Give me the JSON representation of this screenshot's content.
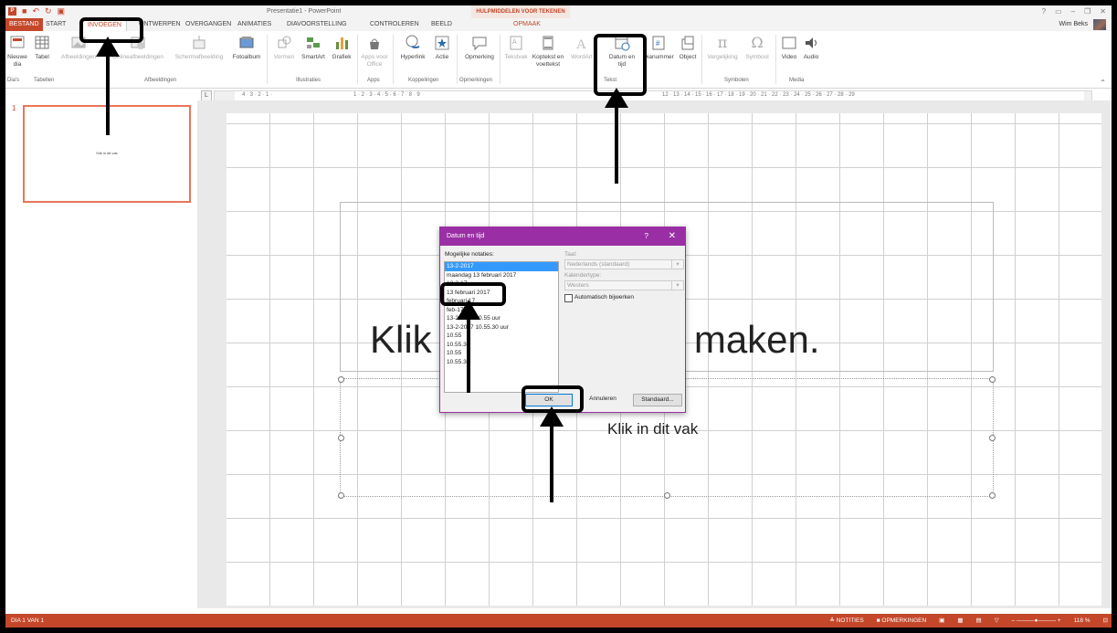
{
  "window": {
    "title": "Presentatie1 - PowerPoint",
    "context_tab": "HULPMIDDELEN VOOR TEKENEN",
    "context_subtab": "OPMAAK",
    "user": "Wim Beks"
  },
  "tabs": [
    "BESTAND",
    "START",
    "INVOEGEN",
    "ONTWERPEN",
    "OVERGANGEN",
    "ANIMATIES",
    "DIAVOORSTELLING",
    "CONTROLEREN",
    "BEELD"
  ],
  "ribbon": {
    "buttons": {
      "new_slide": "Nieuwe dia",
      "table": "Tabel",
      "images": "Afbeeldingen",
      "online_images": "Onlineafbeeldingen",
      "screenshot": "Schermafbeelding",
      "photo_album": "Fotoalbum",
      "shapes": "Vormen",
      "smartart": "SmartArt",
      "chart": "Grafiek",
      "apps": "Apps voor Office",
      "hyperlink": "Hyperlink",
      "action": "Actie",
      "comment": "Opmerking",
      "textbox": "Tekstvak",
      "header_footer": "Koptekst en voettekst",
      "wordart": "WordArt",
      "date_time": "Datum en tijd",
      "slide_number": "Dianummer",
      "object": "Object",
      "equation": "Vergelijking",
      "symbol": "Symbool",
      "video": "Video",
      "audio": "Audio"
    },
    "groups": {
      "slides": "Dia's",
      "tables": "Tabellen",
      "images": "Afbeeldingen",
      "illustrations": "Illustraties",
      "apps": "Apps",
      "links": "Koppelingen",
      "comments": "Opmerkingen",
      "text": "Tekst",
      "symbols": "Symbolen",
      "media": "Media"
    }
  },
  "thumbnail": {
    "number": "1",
    "text": "Klik in dit vak"
  },
  "slide": {
    "title_text": "Klik om een titel te maken.",
    "subtitle_text": "Klik in dit vak"
  },
  "dialog": {
    "title": "Datum en tijd",
    "help": "?",
    "formats_label": "Mogelijke notaties:",
    "formats": [
      "13-2-2017",
      "maandag 13 februari 2017",
      "13-2-17",
      "13 februari 2017",
      "februari 17",
      "feb-17",
      "13-2-2017 10.55 uur",
      "13-2-2017 10.55.30 uur",
      "10.55",
      "10.55.30",
      "10.55",
      "10.55.30"
    ],
    "language_label": "Taal:",
    "language_value": "Nederlands (standaard)",
    "calendar_label": "Kalendertype:",
    "calendar_value": "Westers",
    "auto_update_label": "Automatisch bijwerken",
    "ok": "OK",
    "cancel": "Annuleren",
    "default": "Standaard..."
  },
  "status": {
    "slide": "DIA 1 VAN 1",
    "notes": "NOTITIES",
    "comments": "OPMERKINGEN",
    "zoom": "118 %"
  },
  "colors": {
    "accent": "#c5472a",
    "dialog": "#9a2fa5",
    "selection": "#3399ff"
  }
}
